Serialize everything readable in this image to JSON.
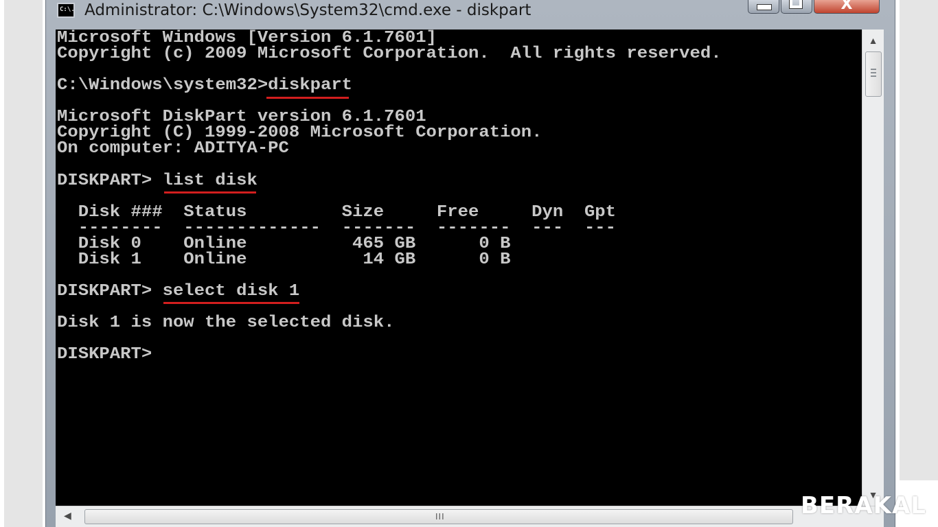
{
  "window": {
    "title": "Administrator: C:\\Windows\\System32\\cmd.exe - diskpart",
    "app_icon_text": "C:\\.",
    "close_glyph": "X"
  },
  "console": {
    "text_color": "#c8c8c8",
    "background": "#000000",
    "highlight_color": "#d21e1e",
    "lines": {
      "l1": "Microsoft Windows [Version 6.1.7601]",
      "l2": "Copyright (c) 2009 Microsoft Corporation.  All rights reserved.",
      "l3": "C:\\Windows\\system32>diskpart",
      "l4": "Microsoft DiskPart version 6.1.7601",
      "l5": "Copyright (C) 1999-2008 Microsoft Corporation.",
      "l6": "On computer: ADITYA-PC",
      "l7": "DISKPART> list disk",
      "l8": "  Disk ###  Status         Size     Free     Dyn  Gpt",
      "l9": "  --------  -------------  -------  -------  ---  ---",
      "l10": "  Disk 0    Online          465 GB      0 B",
      "l11": "  Disk 1    Online           14 GB      0 B",
      "l12": "DISKPART> select disk 1",
      "l13": "Disk 1 is now the selected disk.",
      "l14": "DISKPART>"
    }
  },
  "scrollbar": {
    "horizontal_grip": "III"
  },
  "watermark": {
    "text": "BERAKAL"
  }
}
